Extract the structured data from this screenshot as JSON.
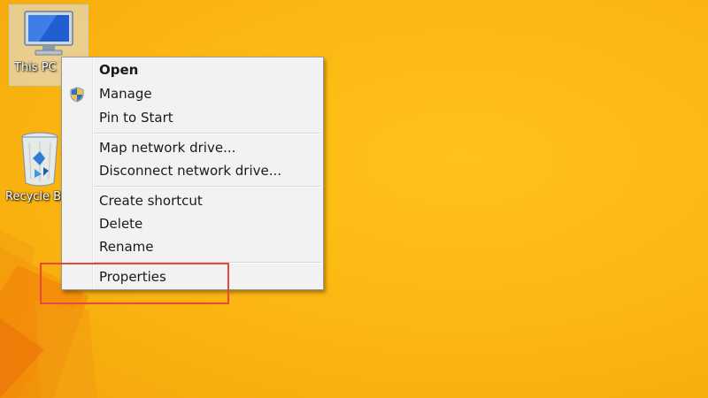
{
  "desktop": {
    "background_color": "#fbb611",
    "icons": [
      {
        "label": "This PC",
        "icon": "computer-monitor-icon",
        "selected": true
      },
      {
        "label": "Recycle Bin",
        "icon": "recycle-bin-icon",
        "selected": false
      }
    ]
  },
  "context_menu": {
    "groups": [
      [
        {
          "label": "Open",
          "bold": true
        },
        {
          "label": "Manage",
          "icon": "uac-shield-icon"
        },
        {
          "label": "Pin to Start"
        }
      ],
      [
        {
          "label": "Map network drive..."
        },
        {
          "label": "Disconnect network drive..."
        }
      ],
      [
        {
          "label": "Create shortcut"
        },
        {
          "label": "Delete"
        },
        {
          "label": "Rename"
        }
      ],
      [
        {
          "label": "Properties",
          "highlighted": true
        }
      ]
    ]
  },
  "annotation": {
    "highlight_color": "#e8483b",
    "target": "Properties"
  }
}
